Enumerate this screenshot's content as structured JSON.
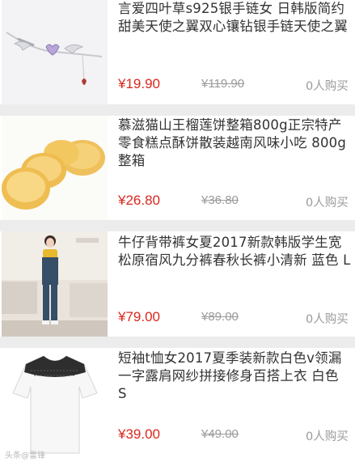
{
  "products": [
    {
      "title": "言爱四叶草s925银手链女 日韩版简约甜美天使之翼双心镶钻银手链天使之翼",
      "price": "¥19.90",
      "original_price": "¥119.90",
      "sold": "0人购买",
      "image": "bracelet-product-photo"
    },
    {
      "title": "慕滋猫山王榴莲饼整箱800g正宗特产零食糕点酥饼散装越南风味小吃 800g整箱",
      "price": "¥26.80",
      "original_price": "¥36.80",
      "sold": "0人购买",
      "image": "durian-pastry-product-photo"
    },
    {
      "title": "牛仔背带裤女夏2017新款韩版学生宽松原宿风九分裤春秋长裤小清新 蓝色 L",
      "price": "¥79.00",
      "original_price": "¥89.00",
      "sold": "0人购买",
      "image": "denim-overalls-product-photo"
    },
    {
      "title": "短袖t恤女2017夏季装新款白色v领漏一字露肩网纱拼接修身百搭上衣 白色 S",
      "price": "¥39.00",
      "original_price": "¥49.00",
      "sold": "0人购买",
      "image": "white-tshirt-product-photo"
    }
  ],
  "watermark": "头条@雷锋"
}
